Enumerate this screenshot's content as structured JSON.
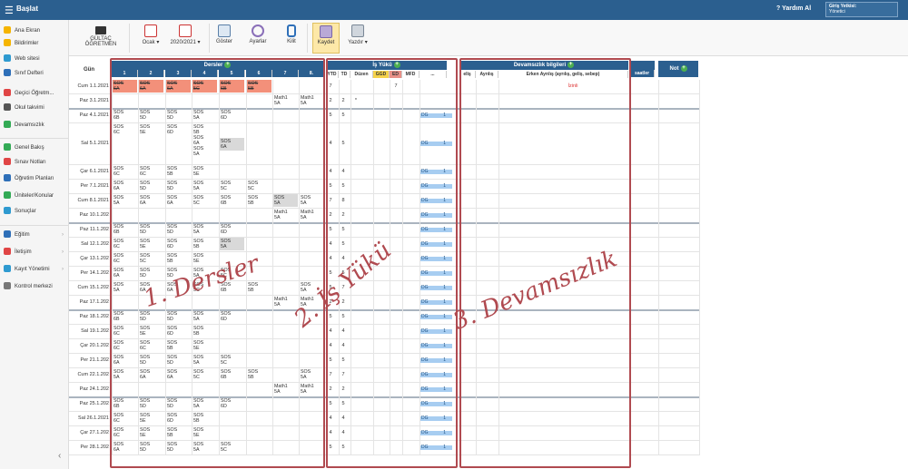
{
  "app": {
    "title": "Başlat",
    "help": "Yardım Al",
    "auth_label": "Giriş Yetkisi:",
    "auth_value": "Yönetici"
  },
  "sidebar": {
    "items": [
      {
        "label": "Ana Ekran",
        "color": "#f5b400"
      },
      {
        "label": "Bildirimler",
        "color": "#f5b400"
      },
      {
        "label": "Web sitesi",
        "color": "#2e9ad0"
      },
      {
        "label": "Sınıf Defteri",
        "color": "#2e6fb8"
      },
      {
        "label": "Geçici Öğretm...",
        "color": "#e04545"
      },
      {
        "label": "Okul takvimi",
        "color": "#555555"
      },
      {
        "label": "Devamsızlık",
        "color": "#33aa55"
      },
      {
        "label": "Genel Bakış",
        "color": "#33aa55"
      },
      {
        "label": "Sınav Notları",
        "color": "#e04545"
      },
      {
        "label": "Öğretim Planları",
        "color": "#2e6fb8"
      },
      {
        "label": "Üniteler/Konular",
        "color": "#33aa55"
      },
      {
        "label": "Sonuçlar",
        "color": "#2e9ad0"
      },
      {
        "label": "Eğitim",
        "color": "#2e6fb8"
      },
      {
        "label": "İletişim",
        "color": "#e04545"
      },
      {
        "label": "Kayıt Yönetimi",
        "color": "#2e9ad0"
      },
      {
        "label": "Kontrol merkezi",
        "color": "#777777"
      }
    ]
  },
  "toolbar": {
    "teacher_line1": "GÜLTAÇ",
    "teacher_line2": "ÖĞRETMEN",
    "month": "Ocak",
    "year": "2020/2021",
    "show": "Göster",
    "settings": "Ayarlar",
    "lock": "Kilit",
    "save": "Kaydet",
    "print": "Yazdır"
  },
  "table": {
    "day_header": "Gün",
    "lessons_header": "Dersler",
    "lesson_cols": [
      "1",
      "2",
      "3",
      "4",
      "5",
      "6",
      "7",
      "8."
    ],
    "workload_header": "İş Yükü",
    "workload_cols": [
      "YTD",
      "TD",
      "Düzen",
      "GGD",
      "ED",
      "MFD",
      "..."
    ],
    "attendance_header": "Devamsızlık bilgileri",
    "attendance_cols": [
      "eliş",
      "Ayrılış",
      "Erken Ayrılış (ayrılış, geliş, sebep)"
    ],
    "extra_cols": [
      "saatler"
    ],
    "note_header": "Not",
    "rows": [
      {
        "day": "Cum 1.1.2021",
        "c": [
          {
            "t": "SOS\n6A",
            "k": "pink"
          },
          {
            "t": "SOS\n6A",
            "k": "pink"
          },
          {
            "t": "SOS\n6A",
            "k": "pink"
          },
          {
            "t": "SOS\n5C",
            "k": "pink"
          },
          {
            "t": "SOS\n6B",
            "k": "pink"
          },
          {
            "t": "SOS\n5B",
            "k": "pink"
          },
          null,
          null
        ],
        "ytd": "7",
        "td": "",
        "ed": "7",
        "dg": "",
        "izin": "İzinli"
      },
      {
        "day": "Paz 3.1.2021",
        "c": [
          null,
          null,
          null,
          null,
          null,
          null,
          {
            "t": "Math1\n5A"
          },
          {
            "t": "Math1\n5A"
          }
        ],
        "ytd": "2",
        "td": "2",
        "dz": "*",
        "dg": ""
      },
      {
        "day": "Paz 4.1.2021",
        "c": [
          {
            "t": "SOS\n6B"
          },
          {
            "t": "SOS\n5D"
          },
          {
            "t": "SOS\n5D"
          },
          {
            "t": "SOS\n5A"
          },
          {
            "t": "SOS\n6D"
          },
          null,
          null,
          null
        ],
        "ytd": "5",
        "td": "5",
        "dg": "1"
      },
      {
        "day": "Sal 5.1.2021",
        "c": [
          {
            "t": "SOS\n6C"
          },
          {
            "t": "SOS\n5E"
          },
          {
            "t": "SOS\n6D"
          },
          {
            "t": "SOS\n5B\nSOS\n6A\nSOS\n5A"
          },
          {
            "t": "SOS\n6A",
            "k": "grey"
          },
          null,
          null,
          null
        ],
        "ytd": "4",
        "td": "5",
        "dg": "1"
      },
      {
        "day": "Çar 6.1.2021",
        "c": [
          {
            "t": "SOS\n6C"
          },
          {
            "t": "SOS\n6C"
          },
          {
            "t": "SOS\n5B"
          },
          {
            "t": "SOS\n5E"
          },
          null,
          null,
          null,
          null
        ],
        "ytd": "4",
        "td": "4",
        "dg": "1"
      },
      {
        "day": "Per 7.1.2021",
        "c": [
          {
            "t": "SOS\n6A"
          },
          {
            "t": "SOS\n5D"
          },
          {
            "t": "SOS\n5D"
          },
          {
            "t": "SOS\n5A"
          },
          {
            "t": "SOS\n5C"
          },
          {
            "t": "SOS\n5C"
          },
          null,
          null
        ],
        "ytd": "5",
        "td": "5",
        "dg": "1"
      },
      {
        "day": "Cum 8.1.2021",
        "c": [
          {
            "t": "SOS\n5A"
          },
          {
            "t": "SOS\n6A"
          },
          {
            "t": "SOS\n6A"
          },
          {
            "t": "SOS\n5C"
          },
          {
            "t": "SOS\n6B"
          },
          {
            "t": "SOS\n5B"
          },
          {
            "t": "SOS\n5A",
            "k": "grey"
          },
          {
            "t": "SOS\n5A"
          }
        ],
        "ytd": "7",
        "td": "8",
        "dg": "1"
      },
      {
        "day": "Paz 10.1.202",
        "c": [
          null,
          null,
          null,
          null,
          null,
          null,
          {
            "t": "Math1\n5A"
          },
          {
            "t": "Math1\n5A"
          }
        ],
        "ytd": "2",
        "td": "2",
        "dg": "1"
      },
      {
        "day": "Paz 11.1.202",
        "c": [
          {
            "t": "SOS\n6B"
          },
          {
            "t": "SOS\n5D"
          },
          {
            "t": "SOS\n5D"
          },
          {
            "t": "SOS\n5A"
          },
          {
            "t": "SOS\n6D"
          },
          null,
          null,
          null
        ],
        "ytd": "5",
        "td": "5",
        "dg": "1"
      },
      {
        "day": "Sal 12.1.202",
        "c": [
          {
            "t": "SOS\n6C"
          },
          {
            "t": "SOS\n5E"
          },
          {
            "t": "SOS\n6D"
          },
          {
            "t": "SOS\n5B"
          },
          {
            "t": "SOS\n5A",
            "k": "grey"
          },
          null,
          null,
          null
        ],
        "ytd": "4",
        "td": "5",
        "dg": "1"
      },
      {
        "day": "Çar 13.1.202",
        "c": [
          {
            "t": "SOS\n6C"
          },
          {
            "t": "SOS\n5C"
          },
          {
            "t": "SOS\n5B"
          },
          {
            "t": "SOS\n5E"
          },
          null,
          null,
          null,
          null
        ],
        "ytd": "4",
        "td": "4",
        "dg": "1"
      },
      {
        "day": "Per 14.1.202",
        "c": [
          {
            "t": "SOS\n6A"
          },
          {
            "t": "SOS\n5D"
          },
          {
            "t": "SOS\n5D"
          },
          {
            "t": "SOS\n5A"
          },
          {
            "t": "SOS\n5C"
          },
          null,
          null,
          null
        ],
        "ytd": "5",
        "td": "5",
        "dg": "1"
      },
      {
        "day": "Cum 15.1.202",
        "c": [
          {
            "t": "SOS\n5A"
          },
          {
            "t": "SOS\n6A"
          },
          {
            "t": "SOS\n6A"
          },
          {
            "t": "SOS\n5C"
          },
          {
            "t": "SOS\n6B"
          },
          {
            "t": "SOS\n5B"
          },
          null,
          {
            "t": "SOS\n5A"
          }
        ],
        "ytd": "5",
        "td": "7",
        "dg": "1"
      },
      {
        "day": "Paz 17.1.202",
        "c": [
          null,
          null,
          null,
          null,
          null,
          null,
          {
            "t": "Math1\n5A"
          },
          {
            "t": "Math1\n5A"
          }
        ],
        "ytd": "2",
        "td": "2",
        "dg": "1"
      },
      {
        "day": "Paz 18.1.202",
        "c": [
          {
            "t": "SOS\n6B"
          },
          {
            "t": "SOS\n5D"
          },
          {
            "t": "SOS\n5D"
          },
          {
            "t": "SOS\n5A"
          },
          {
            "t": "SOS\n6D"
          },
          null,
          null,
          null
        ],
        "ytd": "5",
        "td": "5",
        "dg": "1"
      },
      {
        "day": "Sal 19.1.202",
        "c": [
          {
            "t": "SOS\n6C"
          },
          {
            "t": "SOS\n5E"
          },
          {
            "t": "SOS\n6D"
          },
          {
            "t": "SOS\n5B"
          },
          null,
          null,
          null,
          null
        ],
        "ytd": "4",
        "td": "4",
        "dg": "1"
      },
      {
        "day": "Çar 20.1.202",
        "c": [
          {
            "t": "SOS\n6C"
          },
          {
            "t": "SOS\n6C"
          },
          {
            "t": "SOS\n5B"
          },
          {
            "t": "SOS\n5E"
          },
          null,
          null,
          null,
          null
        ],
        "ytd": "4",
        "td": "4",
        "dg": "1"
      },
      {
        "day": "Per 21.1.202",
        "c": [
          {
            "t": "SOS\n6A"
          },
          {
            "t": "SOS\n5D"
          },
          {
            "t": "SOS\n5D"
          },
          {
            "t": "SOS\n5A"
          },
          {
            "t": "SOS\n5C"
          },
          null,
          null,
          null
        ],
        "ytd": "5",
        "td": "5",
        "dg": "1"
      },
      {
        "day": "Cum 22.1.202",
        "c": [
          {
            "t": "SOS\n5A"
          },
          {
            "t": "SOS\n6A"
          },
          {
            "t": "SOS\n6A"
          },
          {
            "t": "SOS\n5C"
          },
          {
            "t": "SOS\n6B"
          },
          {
            "t": "SOS\n5B"
          },
          null,
          {
            "t": "SOS\n5A"
          }
        ],
        "ytd": "7",
        "td": "7",
        "dg": "1"
      },
      {
        "day": "Paz 24.1.202",
        "c": [
          null,
          null,
          null,
          null,
          null,
          null,
          {
            "t": "Math1\n5A"
          },
          {
            "t": "Math1\n5A"
          }
        ],
        "ytd": "2",
        "td": "2",
        "dg": "1"
      },
      {
        "day": "Paz 25.1.202",
        "c": [
          {
            "t": "SOS\n6B"
          },
          {
            "t": "SOS\n5D"
          },
          {
            "t": "SOS\n5D"
          },
          {
            "t": "SOS\n5A"
          },
          {
            "t": "SOS\n6D"
          },
          null,
          null,
          null
        ],
        "ytd": "5",
        "td": "5",
        "dg": "1"
      },
      {
        "day": "Sal 26.1.2021",
        "c": [
          {
            "t": "SOS\n6C"
          },
          {
            "t": "SOS\n5E"
          },
          {
            "t": "SOS\n6D"
          },
          {
            "t": "SOS\n5B"
          },
          null,
          null,
          null,
          null
        ],
        "ytd": "4",
        "td": "4",
        "dg": "1"
      },
      {
        "day": "Çar 27.1.202",
        "c": [
          {
            "t": "SOS\n6C"
          },
          {
            "t": "SOS\n5E"
          },
          {
            "t": "SOS\n5B"
          },
          {
            "t": "SOS\n5E"
          },
          null,
          null,
          null,
          null
        ],
        "ytd": "4",
        "td": "4",
        "dg": "1"
      },
      {
        "day": "Per 28.1.202",
        "c": [
          {
            "t": "SOS\n6A"
          },
          {
            "t": "SOS\n5D"
          },
          {
            "t": "SOS\n5D"
          },
          {
            "t": "SOS\n5A"
          },
          {
            "t": "SOS\n5C"
          },
          null,
          null,
          null
        ],
        "ytd": "5",
        "td": "5",
        "dg": "1"
      }
    ],
    "dg_label": "DG"
  },
  "annotations": {
    "a1": "1. Dersler",
    "a2": "2. İş Yükü",
    "a3": "3. Devamsızlık"
  }
}
